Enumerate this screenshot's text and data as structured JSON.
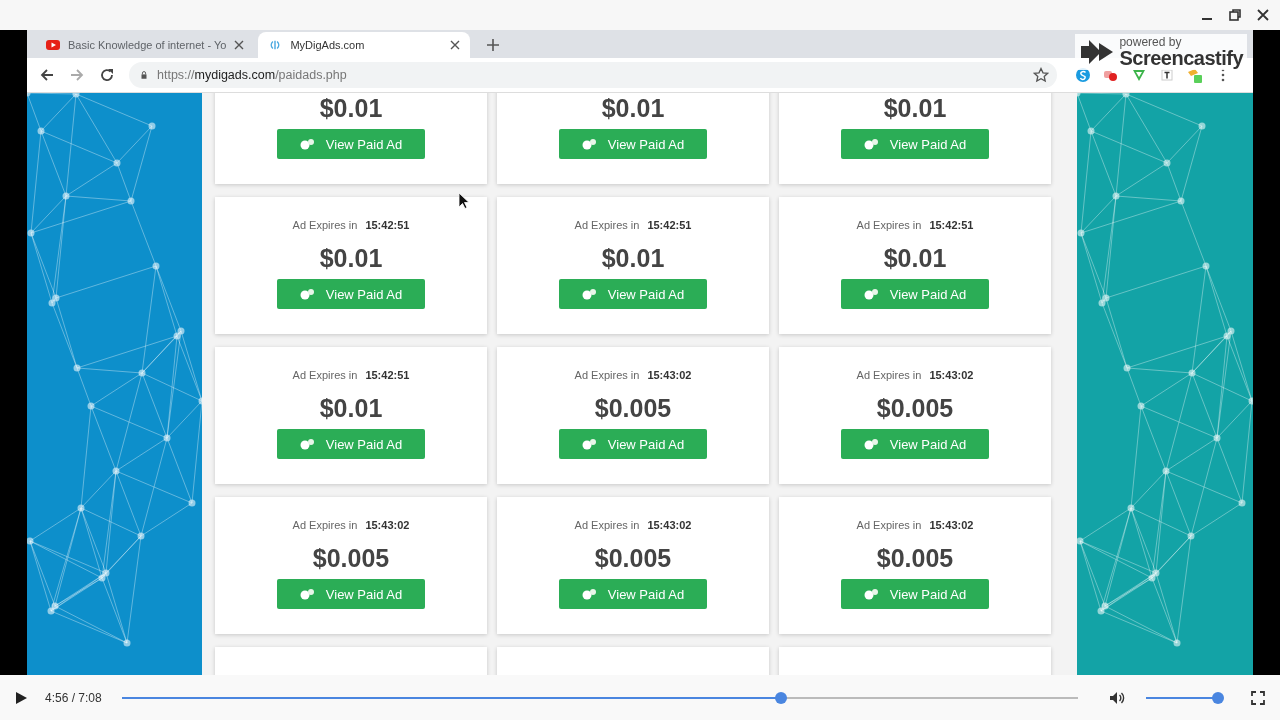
{
  "player": {
    "paused": true,
    "time": "4:56 / 7:08",
    "progress": {
      "level": 0.69
    },
    "volume": {
      "level": 0.97
    }
  },
  "browser": {
    "tabs": [
      {
        "title": "Basic Knowledge of internet - Yo",
        "selected": false
      },
      {
        "title": "MyDigAds.com",
        "selected": true
      }
    ],
    "address": {
      "scheme": "https://",
      "host": "mydigads.com",
      "path": "/paidads.php"
    },
    "recorder_badge": {
      "line_1": "powered by",
      "line_2": "Screencastify"
    }
  },
  "cards": [
    {
      "kind": "ad",
      "price": "$0.01",
      "button": "View Paid Ad"
    },
    {
      "kind": "ad",
      "price": "$0.01",
      "button": "View Paid Ad"
    },
    {
      "kind": "ad",
      "price": "$0.01",
      "button": "View Paid Ad"
    },
    {
      "kind": "ad",
      "expires_label": "Ad Expires in",
      "expires_time": "15:42:51",
      "price": "$0.01",
      "button": "View Paid Ad"
    },
    {
      "kind": "ad",
      "expires_label": "Ad Expires in",
      "expires_time": "15:42:51",
      "price": "$0.01",
      "button": "View Paid Ad"
    },
    {
      "kind": "ad",
      "expires_label": "Ad Expires in",
      "expires_time": "15:42:51",
      "price": "$0.01",
      "button": "View Paid Ad"
    },
    {
      "kind": "ad",
      "expires_label": "Ad Expires in",
      "expires_time": "15:42:51",
      "price": "$0.01",
      "button": "View Paid Ad"
    },
    {
      "kind": "ad",
      "expires_label": "Ad Expires in",
      "expires_time": "15:43:02",
      "price": "$0.005",
      "button": "View Paid Ad"
    },
    {
      "kind": "ad",
      "expires_label": "Ad Expires in",
      "expires_time": "15:43:02",
      "price": "$0.005",
      "button": "View Paid Ad"
    },
    {
      "kind": "ad",
      "expires_label": "Ad Expires in",
      "expires_time": "15:43:02",
      "price": "$0.005",
      "button": "View Paid Ad"
    },
    {
      "kind": "ad",
      "expires_label": "Ad Expires in",
      "expires_time": "15:43:02",
      "price": "$0.005",
      "button": "View Paid Ad"
    },
    {
      "kind": "ad",
      "expires_label": "Ad Expires in",
      "expires_time": "15:43:02",
      "price": "$0.005",
      "button": "View Paid Ad"
    },
    {
      "kind": "cut_off"
    },
    {
      "kind": "cut_off"
    },
    {
      "kind": "cut_off"
    }
  ]
}
